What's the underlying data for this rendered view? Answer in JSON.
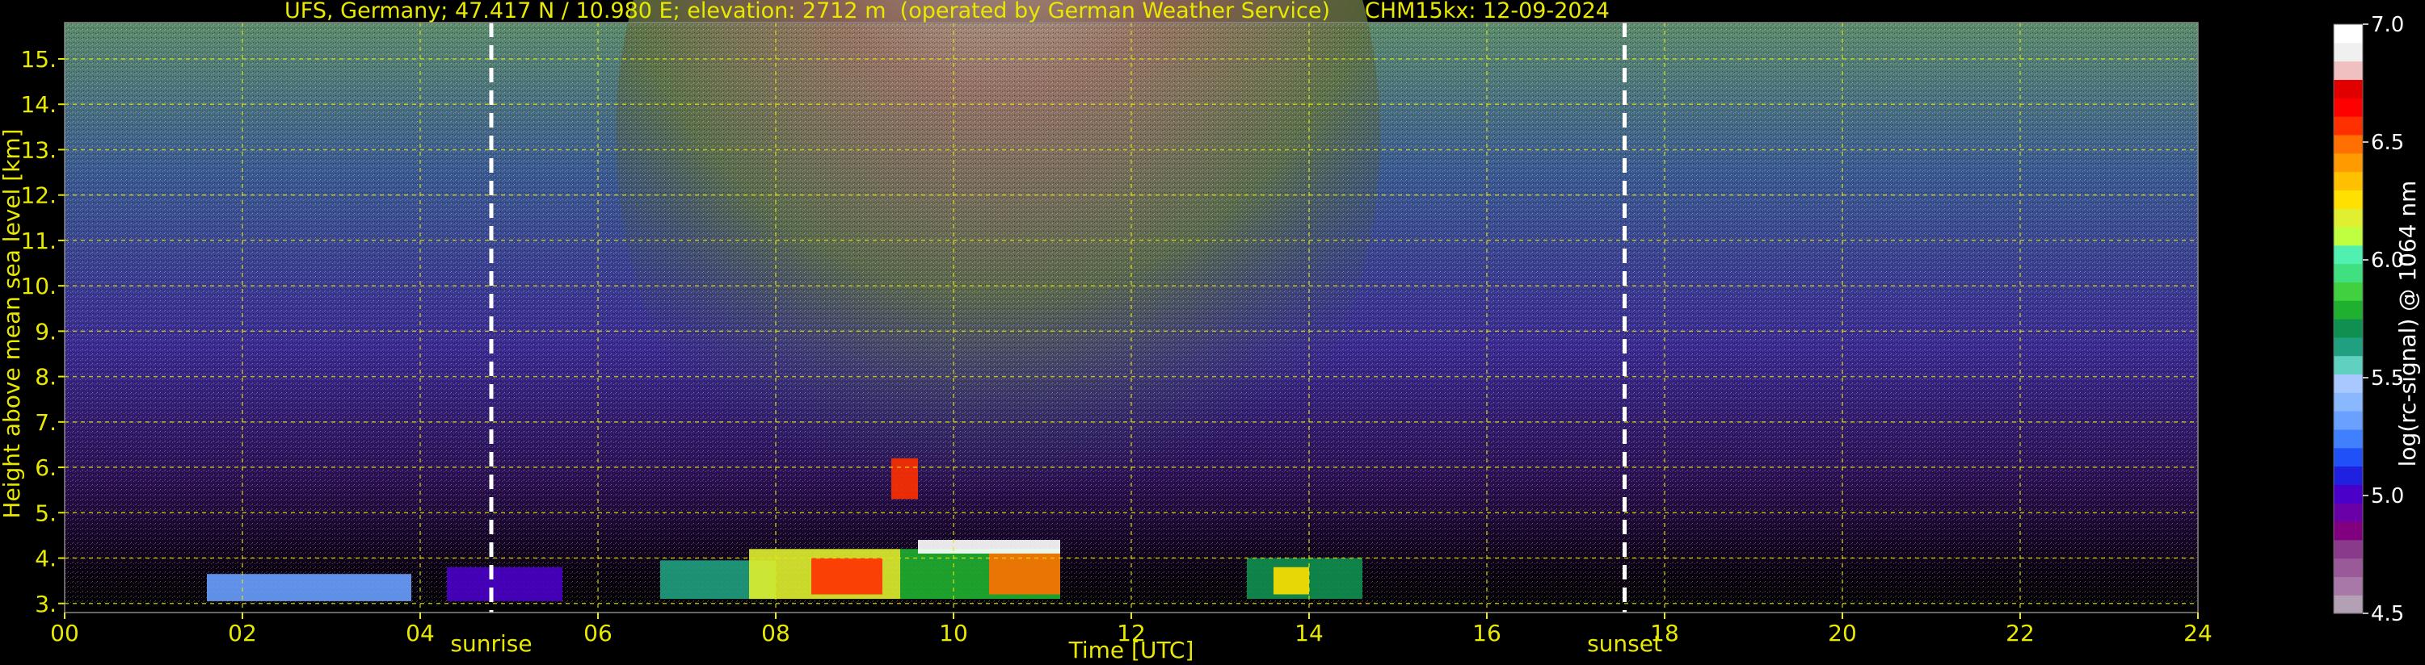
{
  "chart_data": {
    "type": "heatmap",
    "title": "UFS, Germany; 47.417 N / 10.980 E; elevation: 2712 m  (operated by German Weather Service)     CHM15kx: 12-09-2024",
    "xlabel": "Time [UTC]",
    "ylabel": "Height above mean sea level [km]",
    "xlim": [
      0,
      24
    ],
    "ylim": [
      2.8,
      15.8
    ],
    "x_ticks": [
      0,
      2,
      4,
      6,
      8,
      10,
      12,
      14,
      16,
      18,
      20,
      22,
      24
    ],
    "x_tick_labels": [
      "00",
      "02",
      "04",
      "06",
      "08",
      "10",
      "12",
      "14",
      "16",
      "18",
      "20",
      "22",
      "24"
    ],
    "y_ticks": [
      3,
      4,
      5,
      6,
      7,
      8,
      9,
      10,
      11,
      12,
      13,
      14,
      15
    ],
    "y_tick_labels": [
      "3.",
      "4.",
      "5.",
      "6.",
      "7.",
      "8.",
      "9.",
      "10.",
      "11.",
      "12.",
      "13.",
      "14.",
      "15."
    ],
    "grid": true,
    "annotations": [
      {
        "label": "sunrise",
        "x": 4.8
      },
      {
        "label": "sunset",
        "x": 17.55
      }
    ],
    "colorbar": {
      "label": "log(rc-signal) @ 1064 nm",
      "range": [
        4.5,
        7.0
      ],
      "ticks": [
        4.5,
        5.0,
        5.5,
        6.0,
        6.5,
        7.0
      ],
      "tick_labels": [
        "4.5",
        "5.0",
        "5.5",
        "6.0",
        "6.5",
        "7.0"
      ],
      "colors": [
        "#b4a0b4",
        "#a878a8",
        "#9a5a9a",
        "#8a3a8a",
        "#800080",
        "#6a00a8",
        "#4a00c8",
        "#2020e0",
        "#2050f8",
        "#4080ff",
        "#6aa0ff",
        "#8ab8ff",
        "#a8c8ff",
        "#60d0c0",
        "#20a080",
        "#109050",
        "#20b030",
        "#40d040",
        "#40e080",
        "#50f0b0",
        "#c0ff40",
        "#e0f030",
        "#ffe000",
        "#ffc000",
        "#ff9a00",
        "#ff7000",
        "#ff3000",
        "#ff0000",
        "#e00000",
        "#f0c0c0",
        "#f0f0f0",
        "#ffffff"
      ]
    },
    "signal_regions": [
      {
        "x0": 1.6,
        "x1": 3.9,
        "y0": 3.05,
        "y1": 3.65,
        "level": 5.3
      },
      {
        "x0": 4.3,
        "x1": 5.6,
        "y0": 3.05,
        "y1": 3.8,
        "level": 5.0
      },
      {
        "x0": 6.7,
        "x1": 8.0,
        "y0": 3.1,
        "y1": 3.95,
        "level": 5.6
      },
      {
        "x0": 7.7,
        "x1": 9.4,
        "y0": 3.1,
        "y1": 4.2,
        "level": 6.2
      },
      {
        "x0": 8.4,
        "x1": 9.2,
        "y0": 3.2,
        "y1": 4.0,
        "level": 6.6
      },
      {
        "x0": 9.4,
        "x1": 11.2,
        "y0": 3.1,
        "y1": 4.2,
        "level": 5.8
      },
      {
        "x0": 10.4,
        "x1": 11.2,
        "y0": 3.2,
        "y1": 4.1,
        "level": 6.5
      },
      {
        "x0": 9.3,
        "x1": 9.6,
        "y0": 5.3,
        "y1": 6.2,
        "level": 6.6
      },
      {
        "x0": 13.3,
        "x1": 14.6,
        "y0": 3.1,
        "y1": 4.0,
        "level": 5.7
      },
      {
        "x0": 13.6,
        "x1": 14.0,
        "y0": 3.2,
        "y1": 3.8,
        "level": 6.3
      },
      {
        "x0": 9.6,
        "x1": 11.2,
        "y0": 4.1,
        "y1": 4.4,
        "level": 7.0
      }
    ]
  }
}
